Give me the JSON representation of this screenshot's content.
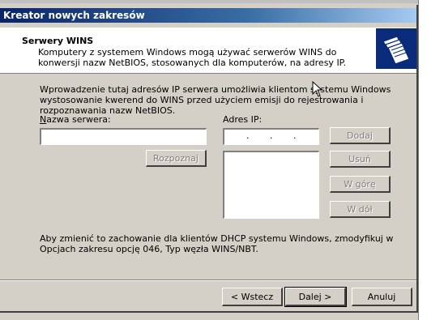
{
  "window": {
    "title": "Kreator nowych zakresów"
  },
  "header": {
    "title": "Serwery WINS",
    "subtitle": "Komputery z systemem Windows mogą używać serwerów WINS do konwersji nazw NetBIOS, stosowanych dla komputerów, na adresy IP.",
    "icon": "folder-stack-icon"
  },
  "intro": "Wprowadzenie tutaj adresów IP serwera umożliwia klientom systemu Windows wystosowanie kwerend do WINS przed użyciem emisji do rejestrowania i rozpoznawania nazw NetBIOS.",
  "server": {
    "label": "Nazwa serwera:",
    "value": "",
    "resolve_button": "Rozpoznaj"
  },
  "ip": {
    "label": "Adres IP:",
    "value": "",
    "dots": [
      ".",
      ".",
      "."
    ],
    "list": []
  },
  "side_buttons": {
    "add": "Dodaj",
    "remove": "Usuń",
    "up": "W górę",
    "down": "W dół"
  },
  "note": "Aby zmienić to zachowanie dla klientów DHCP systemu Windows, zmodyfikuj w Opcjach zakresu opcję 046, Typ węzła WINS/NBT.",
  "footer": {
    "back": "< Wstecz",
    "next": "Dalej >",
    "cancel": "Anuluj"
  },
  "colors": {
    "title_bar": "#0a246a",
    "dialog_bg": "#d4d0c8"
  }
}
